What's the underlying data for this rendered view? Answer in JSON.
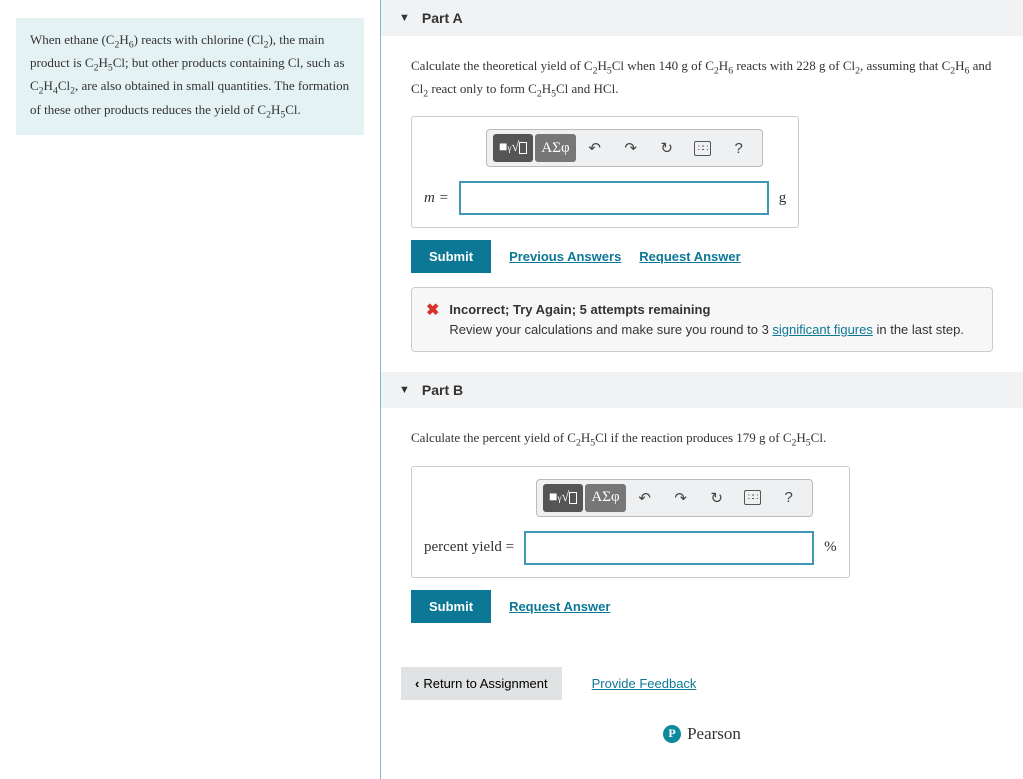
{
  "intro": {
    "text_before": "When ethane (C₂H₆) reacts with chlorine (Cl₂), the main product is C₂H₅Cl; but other products containing Cl, such as C₂H₄Cl₂, are also obtained in small quantities. The formation of these other products reduces the yield of C₂H₅Cl."
  },
  "partA": {
    "title": "Part A",
    "prompt_1": "Calculate the theoretical yield of C₂H₅Cl when 140 g of C₂H₆ reacts with 228 g of Cl₂, assuming that C₂H₆ and Cl₂ react only to form C₂H₅Cl and HCl.",
    "var_label": "m =",
    "unit": "g",
    "submit": "Submit",
    "prev_answers": "Previous Answers",
    "request_answer": "Request Answer",
    "feedback_title": "Incorrect; Try Again; 5 attempts remaining",
    "feedback_body_1": "Review your calculations and make sure you round to 3 ",
    "feedback_link": "significant figures",
    "feedback_body_2": " in the last step."
  },
  "partB": {
    "title": "Part B",
    "prompt": "Calculate the percent yield of C₂H₅Cl if the reaction produces 179 g of C₂H₅Cl.",
    "var_label": "percent yield =",
    "unit": "%",
    "submit": "Submit",
    "request_answer": "Request Answer"
  },
  "toolbar": {
    "templates": "■ᵧ√□",
    "greek": "ΑΣφ",
    "undo": "↶",
    "redo": "↷",
    "reset": "↻",
    "keyboard": "⌨",
    "help": "?"
  },
  "footer": {
    "return": "Return to Assignment",
    "provide_feedback": "Provide Feedback",
    "pearson": "Pearson"
  }
}
